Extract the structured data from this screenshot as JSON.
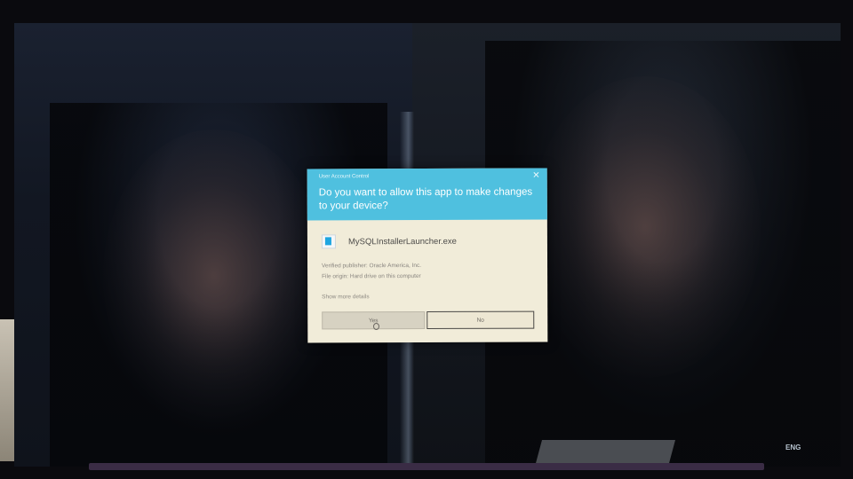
{
  "dialog": {
    "title": "User Account Control",
    "close_glyph": "✕",
    "question": "Do you want to allow this app to make changes to your device?",
    "app_name": "MySQLInstallerLauncher.exe",
    "app_icon": "installer-app-icon",
    "publisher": "Verified publisher: Oracle America, Inc.",
    "file_origin": "File origin: Hard drive on this computer",
    "more_details": "Show more details",
    "yes_label": "Yes",
    "no_label": "No",
    "header_color": "#4fc0df",
    "body_color": "#f1ecd9"
  },
  "taskbar": {
    "language": "ENG"
  }
}
